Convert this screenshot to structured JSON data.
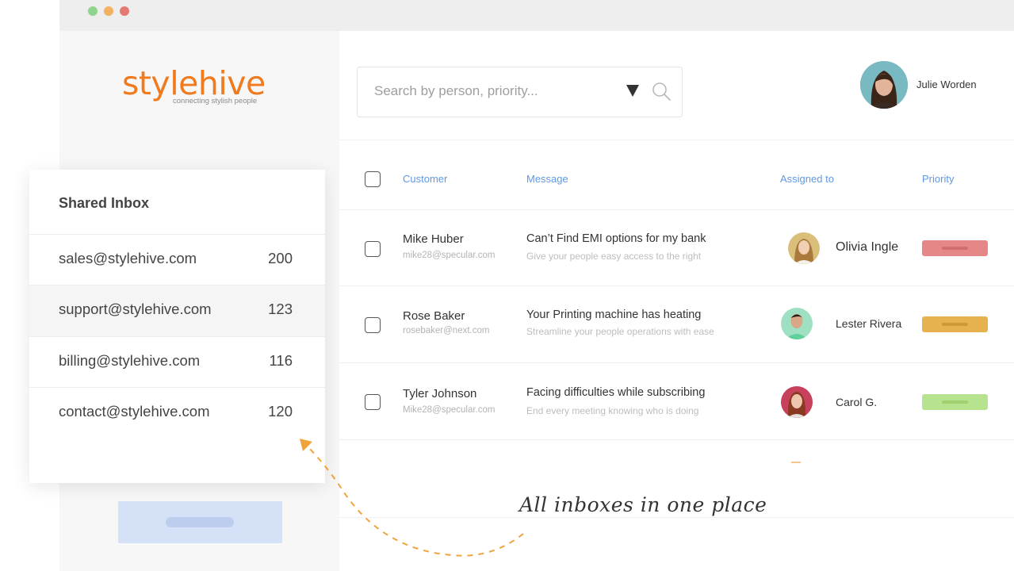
{
  "window": {
    "traffic_lights": [
      "#8fd48d",
      "#f3b162",
      "#e57a73"
    ]
  },
  "brand": {
    "logo_part1": "style",
    "logo_part2": "hive",
    "tagline": "connecting stylish people",
    "logo_color": "#f07a1e"
  },
  "search": {
    "placeholder": "Search by person, priority..."
  },
  "user": {
    "name": "Julie Worden"
  },
  "table": {
    "headers": {
      "customer": "Customer",
      "message": "Message",
      "assigned": "Assigned to",
      "priority": "Priority"
    },
    "rows": [
      {
        "name": "Mike Huber",
        "email": "mike28@specular.com",
        "title": "Can’t Find EMI options for my bank",
        "subtitle": "Give your people easy access to the right",
        "assignee": "Olivia Ingle",
        "priority_color": "#e58787"
      },
      {
        "name": "Rose Baker",
        "email": "rosebaker@next.com",
        "title": "Your Printing machine has heating",
        "subtitle": "Streamline your people operations with ease",
        "assignee": "Lester Rivera",
        "priority_color": "#e7b14f"
      },
      {
        "name": "Tyler Johnson",
        "email": "Mike28@specular.com",
        "title": "Facing difficulties while subscribing",
        "subtitle": "End every meeting knowing who is doing",
        "assignee": "Carol G.",
        "priority_color": "#b8e38e"
      }
    ]
  },
  "inbox": {
    "title": "Shared Inbox",
    "items": [
      {
        "email": "sales@stylehive.com",
        "count": "200"
      },
      {
        "email": "support@stylehive.com",
        "count": "123"
      },
      {
        "email": "billing@stylehive.com",
        "count": "116"
      },
      {
        "email": "contact@stylehive.com",
        "count": "120"
      }
    ]
  },
  "annotation": "All inboxes in one place"
}
